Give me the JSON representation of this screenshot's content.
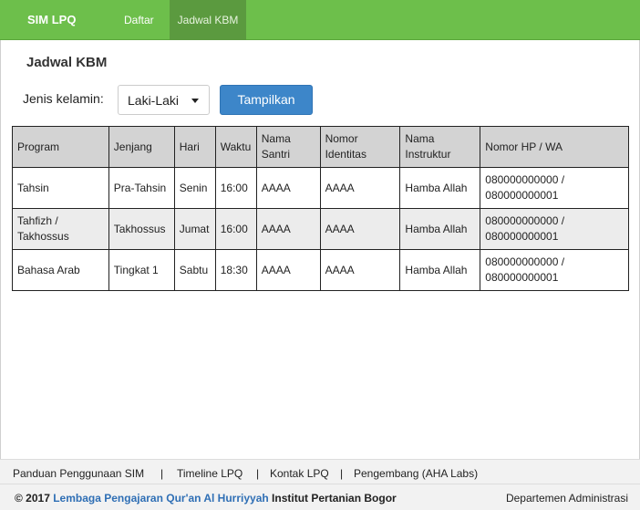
{
  "navbar": {
    "brand": "SIM LPQ",
    "links": [
      {
        "label": "Daftar"
      },
      {
        "label": "Jadwal KBM",
        "active": true
      }
    ],
    "color": "#6dbf4b"
  },
  "page": {
    "title": "Jadwal KBM"
  },
  "filter": {
    "label": "Jenis kelamin:",
    "selected": "Laki-Laki",
    "button_label": "Tampilkan"
  },
  "table": {
    "headers": [
      "Program",
      "Jenjang",
      "Hari",
      "Waktu",
      "Nama Santri",
      "Nomor Identitas",
      "Nama Instruktur",
      "Nomor HP / WA"
    ],
    "rows": [
      [
        "Tahsin",
        "Pra-Tahsin",
        "Senin",
        "16:00",
        "AAAA",
        "AAAA",
        "Hamba Allah",
        "080000000000 / 080000000001"
      ],
      [
        "Tahfizh / Takhossus",
        "Takhossus",
        "Jumat",
        "16:00",
        "AAAA",
        "AAAA",
        "Hamba Allah",
        "080000000000 / 080000000001"
      ],
      [
        "Bahasa Arab",
        "Tingkat 1",
        "Sabtu",
        "18:30",
        "AAAA",
        "AAAA",
        "Hamba Allah",
        "080000000000 / 080000000001"
      ]
    ]
  },
  "footer": {
    "links": [
      "Panduan Penggunaan SIM",
      "Timeline LPQ",
      "Kontak LPQ",
      "Pengembang (AHA Labs)"
    ],
    "separator": "|",
    "copyright_prefix": "© 2017",
    "institution_link": "Lembaga Pengajaran Qur'an Al Hurriyyah",
    "institution_suffix": "Institut Pertanian Bogor",
    "department": "Departemen Administrasi"
  }
}
